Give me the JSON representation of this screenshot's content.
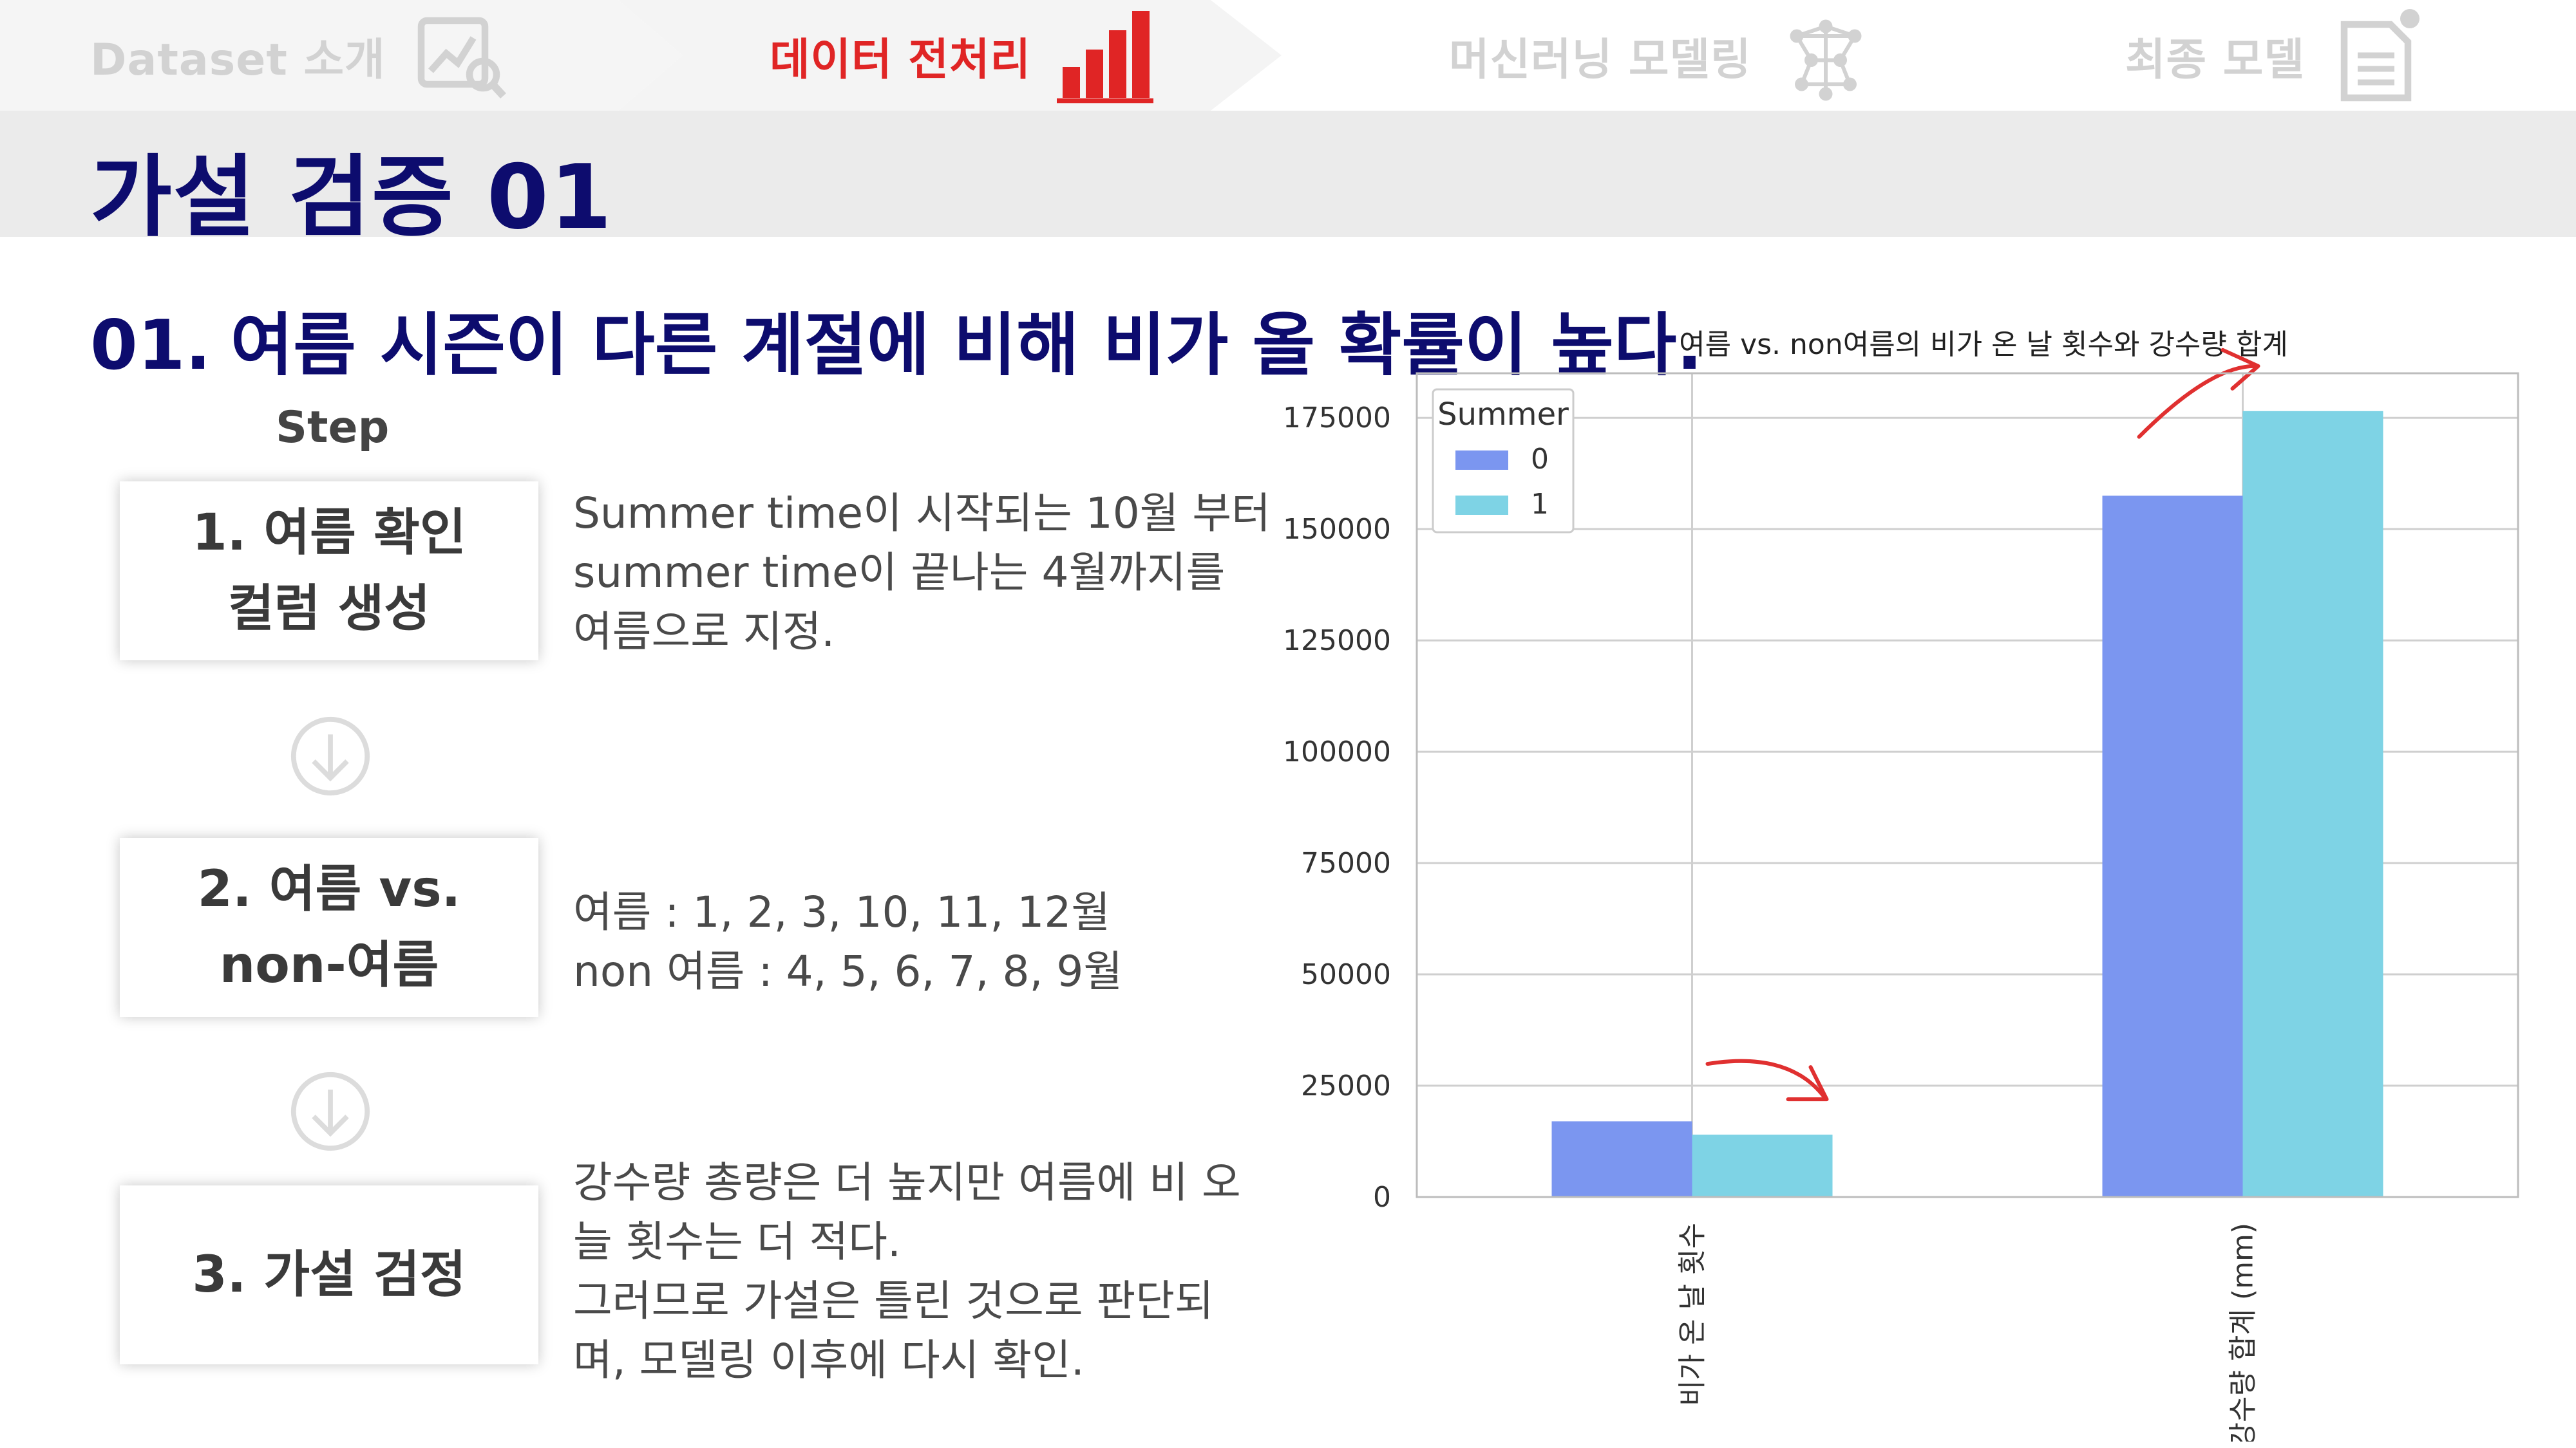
{
  "nav": {
    "steps": [
      {
        "label": "Dataset 소개",
        "icon": "chart-analysis-icon",
        "state": "inactive"
      },
      {
        "label": "데이터 전처리",
        "icon": "bar-chart-icon",
        "state": "active"
      },
      {
        "label": "머신러닝 모델링",
        "icon": "neural-network-icon",
        "state": "inactive"
      },
      {
        "label": "최종 모델",
        "icon": "document-icon",
        "state": "inactive"
      }
    ],
    "active_color": "#e02525",
    "inactive_color": "#d2d2d2"
  },
  "page": {
    "title": "가설 검증 01",
    "hypothesis_number": "01.",
    "hypothesis_text": "여름 시즌이 다른 계절에 비해 비가 올 확률이 높다.",
    "step_label": "Step"
  },
  "steps": [
    {
      "title_lines": [
        "1.   여름 확인",
        "컬럼 생성"
      ],
      "desc_lines": [
        "Summer time이 시작되는 10월 부터",
        "summer time이 끝나는 4월까지를",
        "여름으로 지정."
      ]
    },
    {
      "title_lines": [
        "2. 여름 vs.",
        "non-여름"
      ],
      "desc_lines": [
        "여름 : 1, 2, 3, 10, 11, 12월",
        "non 여름 : 4, 5, 6, 7, 8, 9월"
      ]
    },
    {
      "title_lines": [
        "3. 가설 검정"
      ],
      "desc_lines": [
        "강수량 총량은 더 높지만 여름에 비 오",
        "늘 횟수는 더 적다.",
        "그러므로 가설은 틀린 것으로 판단되",
        "며, 모델링 이후에 다시 확인."
      ]
    }
  ],
  "chart_data": {
    "type": "bar",
    "title": "여름 vs. non여름의 비가 온 날 횟수와 강수량 합계",
    "categories": [
      "비가 온 날 횟수",
      "강수량 합계 (mm)"
    ],
    "series": [
      {
        "name": "0",
        "values": [
          17000,
          157500
        ],
        "color": "#7b96f0"
      },
      {
        "name": "1",
        "values": [
          14000,
          176500
        ],
        "color": "#7ed3e5"
      }
    ],
    "legend_title": "Summer",
    "legend_position": "top-left",
    "ylim": [
      0,
      185000
    ],
    "yticks": [
      0,
      25000,
      50000,
      75000,
      100000,
      125000,
      150000,
      175000
    ],
    "grid": true,
    "annotations": [
      {
        "type": "arrow",
        "target": "비가 온 날 횟수",
        "color": "#e03030"
      },
      {
        "type": "arrow",
        "target": "강수량 합계 (mm)",
        "color": "#e03030"
      }
    ]
  }
}
